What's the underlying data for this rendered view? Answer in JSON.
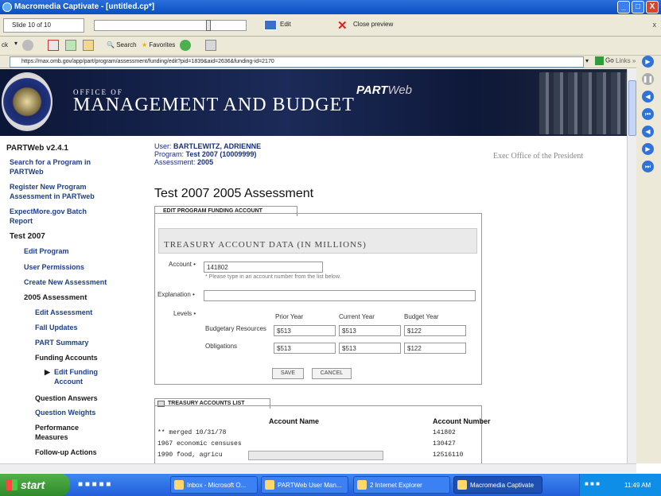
{
  "window": {
    "title": "Macromedia Captivate - [untitled.cp*]",
    "min": "_",
    "max": "□",
    "close": "X"
  },
  "captivate": {
    "slide": "Slide 10 of 10",
    "edit": "Edit",
    "close_preview": "Close preview",
    "close_x": "x"
  },
  "ie": {
    "back": "ck",
    "search": "Search",
    "favorites": "Favorites"
  },
  "address": {
    "url": "https://max.omb.gov/app/part/program/assessment/funding/edit?pid=1839&aid=2636&funding-id=2170",
    "go": "Go",
    "links": "Links »"
  },
  "banner": {
    "office_of": "OFFICE OF",
    "management": "MANAGEMENT AND BUDGET",
    "partweb": "PART",
    "partweb2": "Web"
  },
  "sidebar": {
    "version": "PARTWeb v2.4.1",
    "search1": "Search for a Program in",
    "search2": "PARTWeb",
    "reg1": "Register New Program",
    "reg2": "Assessment in PARTweb",
    "exp1": "ExpectMore.gov Batch",
    "exp2": "Report",
    "test2007": "Test 2007",
    "edit_program": "Edit Program",
    "user_permissions": "User Permissions",
    "create_assessment": "Create New Assessment",
    "assessment_2005": "2005 Assessment",
    "edit_assessment": "Edit Assessment",
    "fall_updates": "Fall Updates",
    "part_summary": "PART Summary",
    "funding_accounts": "Funding Accounts",
    "edit_funding1": "Edit Funding",
    "edit_funding2": "Account",
    "question_answers": "Question Answers",
    "question_weights": "Question Weights",
    "performance1": "Performance",
    "performance2": "Measures",
    "followup": "Follow-up Actions"
  },
  "user": {
    "user_label": "User:",
    "user": "BARTLEWITZ, ADRIENNE",
    "program_label": "Program:",
    "program": "Test 2007 (10009999)",
    "assessment_label": "Assessment:",
    "assessment": "2005"
  },
  "exec_office": "Exec Office of the President",
  "page_title": "Test 2007 2005 Assessment",
  "edit_tab": "EDIT PROGRAM FUNDING ACCOUNT",
  "treasury_header": "TREASURY ACCOUNT DATA (IN MILLIONS)",
  "form": {
    "account_label": "Account •",
    "account_value": "141802",
    "account_hint": "* Please type in an account number from the list below.",
    "explanation_label": "Explanation •",
    "explanation_value": "",
    "levels_label": "Levels •",
    "col_prior": "Prior Year",
    "col_current": "Current Year",
    "col_budget": "Budget Year",
    "row_budgetary": "Budgetary Resources",
    "row_obligations": "Obligations",
    "budgetary": [
      "$513",
      "$513",
      "$122"
    ],
    "obligations": [
      "$513",
      "$513",
      "$122"
    ],
    "save": "SAVE",
    "cancel": "CANCEL"
  },
  "list_tab": "TREASURY ACCOUNTS LIST",
  "list": {
    "col_name": "Account Name",
    "col_number": "Account Number",
    "rows": [
      {
        "name": "** merged 10/31/78",
        "number": "141802"
      },
      {
        "name": "1967 economic censuses",
        "number": "130427"
      },
      {
        "name": "1990 food, agricu",
        "number": "12516110"
      }
    ]
  },
  "taskbar": {
    "start": "start",
    "tasks": [
      "Inbox - Microsoft O...",
      "PARTWeb User Man...",
      "2 Internet Explorer",
      "Macromedia Captivate"
    ],
    "clock": "11:49 AM"
  }
}
